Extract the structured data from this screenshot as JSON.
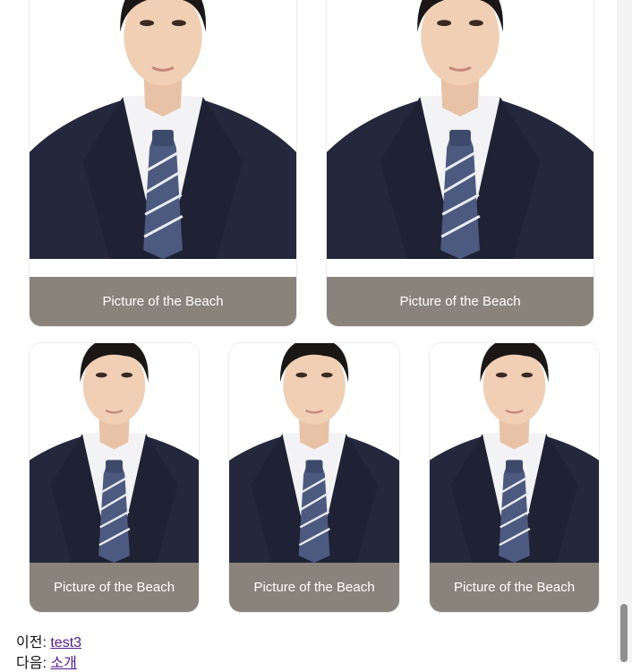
{
  "gallery": {
    "top_row": [
      {
        "caption": "Picture of the Beach",
        "image": "portrait-photo"
      },
      {
        "caption": "Picture of the Beach",
        "image": "portrait-photo"
      }
    ],
    "bottom_row": [
      {
        "caption": "Picture of the Beach",
        "image": "portrait-photo"
      },
      {
        "caption": "Picture of the Beach",
        "image": "portrait-photo"
      },
      {
        "caption": "Picture of the Beach",
        "image": "portrait-photo"
      }
    ]
  },
  "post_nav": {
    "prev_label": "이전:",
    "prev_link": "test3",
    "next_label": "다음:",
    "next_link": "소개"
  },
  "colors": {
    "caption_bg": "#8a837b",
    "suit": "#25273d",
    "link": "#551a8b"
  }
}
